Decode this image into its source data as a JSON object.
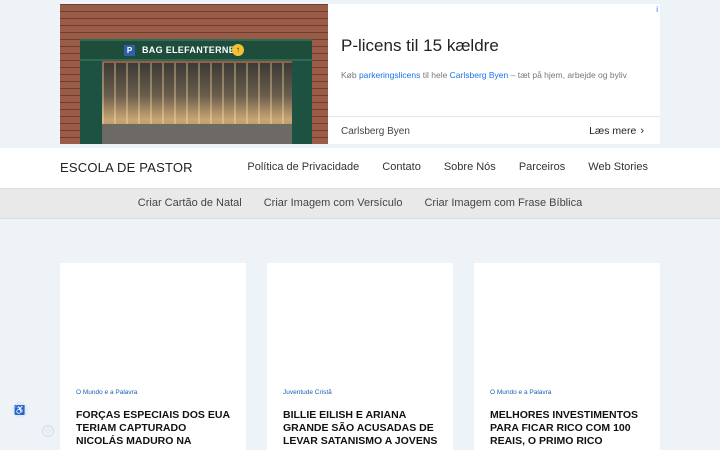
{
  "ad": {
    "choices_icon": "i",
    "sign_text": "BAG ELEFANTERNE",
    "headline": "P-licens til 15 kældre",
    "body_pre": "Køb ",
    "body_link1": "parkeringslicens",
    "body_mid": " til hele ",
    "body_link2": "Carlsberg Byen",
    "body_post": " – tæt på hjem, arbejde og byliv",
    "advertiser": "Carlsberg Byen",
    "cta": "Læs mere"
  },
  "header": {
    "logo": "ESCOLA DE PASTOR",
    "nav": [
      "Política de Privacidade",
      "Contato",
      "Sobre Nós",
      "Parceiros",
      "Web Stories"
    ]
  },
  "subnav": [
    "Criar Cartão de Natal",
    "Criar Imagem com Versículo",
    "Criar Imagem com Frase Bíblica"
  ],
  "cards": [
    {
      "category": "O Mundo e a Palavra",
      "title": "FORÇAS ESPECIAIS DOS EUA TERIAM CAPTURADO NICOLÁS MADURO NA VENEZUELA,"
    },
    {
      "category": "Juventude Cristã",
      "title": "BILLIE EILISH E ARIANA GRANDE SÃO ACUSADAS DE LEVAR SATANISMO A JOVENS"
    },
    {
      "category": "O Mundo e a Palavra",
      "title": "MELHORES INVESTIMENTOS PARA FICAR RICO COM 100 REAIS, O PRIMO RICO DETALHA"
    }
  ],
  "icons": {
    "ad_choices": "info-icon",
    "cta_chevron": "chevron-right-icon",
    "float": "accessibility-icon"
  },
  "colors": {
    "page_bg": "#eef3f8",
    "link_blue": "#1a73e8",
    "category_blue": "#1a5fb4"
  }
}
